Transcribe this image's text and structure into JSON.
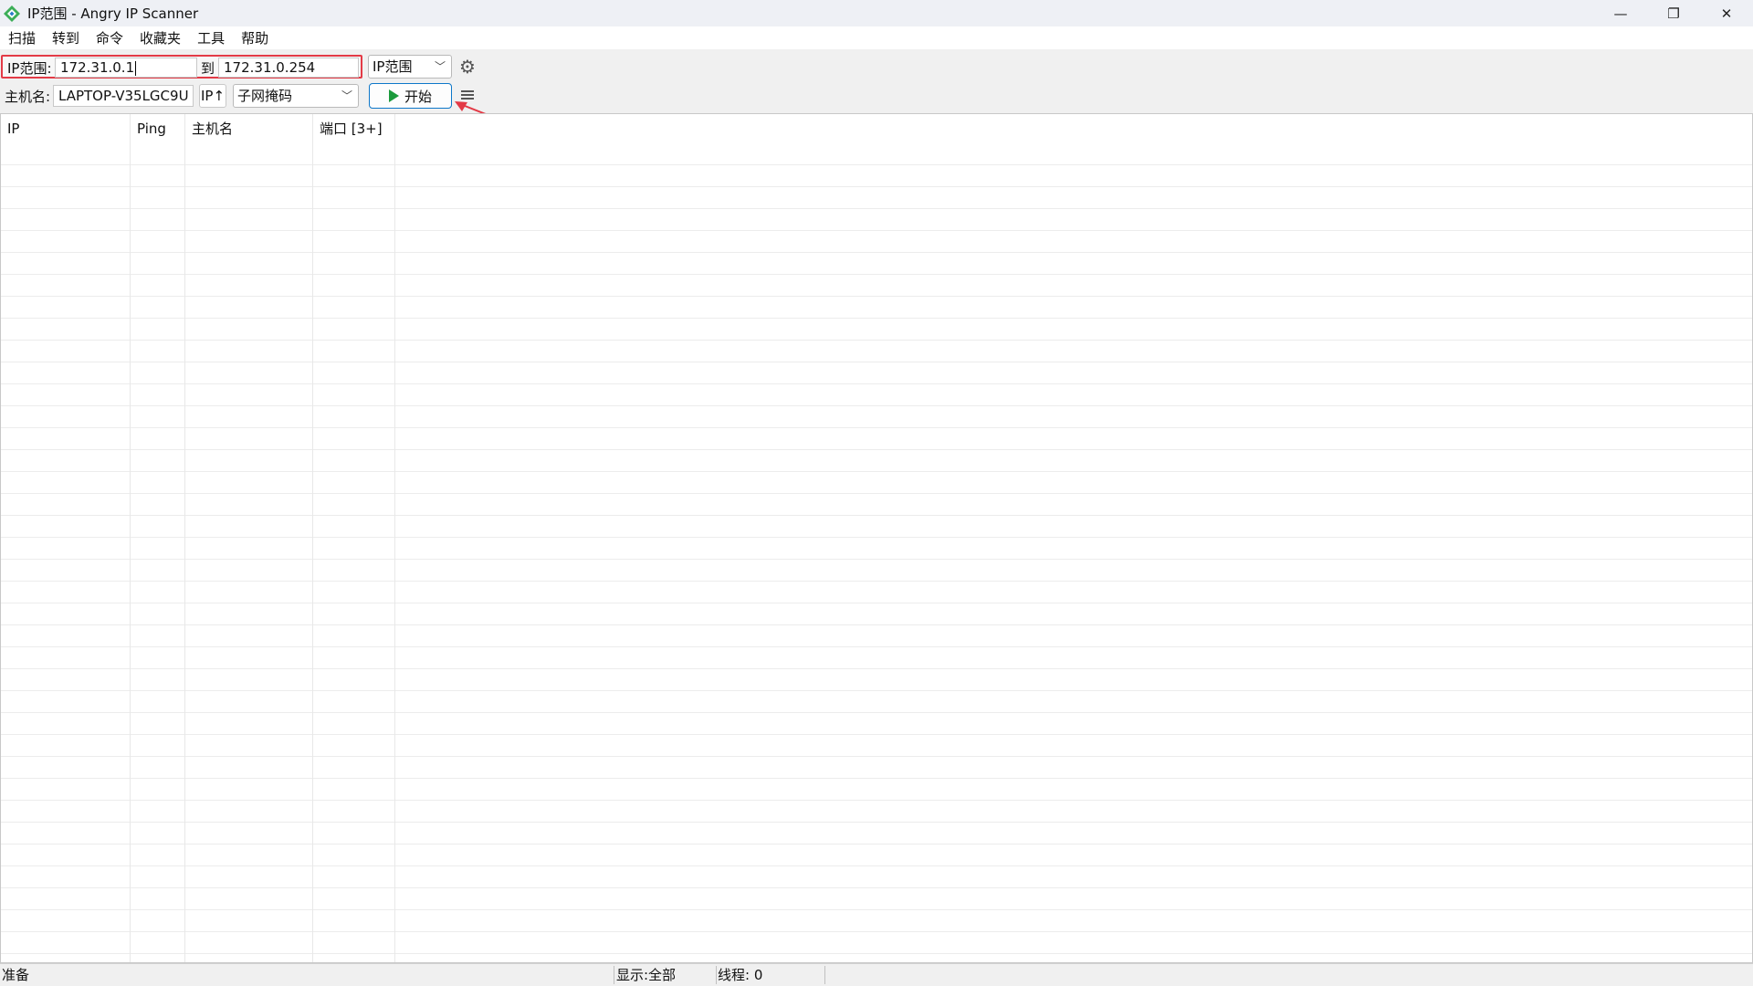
{
  "window": {
    "title": "IP范围 - Angry IP Scanner",
    "controls": {
      "minimize": "—",
      "maximize": "❐",
      "close": "✕"
    }
  },
  "menu": [
    "扫描",
    "转到",
    "命令",
    "收藏夹",
    "工具",
    "帮助"
  ],
  "toolbar": {
    "range_label": "IP范围:",
    "start_ip": "172.31.0.1",
    "to_label": "到",
    "end_ip": "172.31.0.254",
    "feeder_select": "IP范围",
    "hostname_label": "主机名:",
    "hostname_value": "LAPTOP-V35LGC9U",
    "ip_button": "IP↑",
    "netmask_select": "子网掩码",
    "start_button": "开始"
  },
  "table": {
    "columns": [
      "IP",
      "Ping",
      "主机名",
      "端口 [3+]"
    ]
  },
  "status": {
    "ready": "准备",
    "display": "显示:全部",
    "threads": "线程: 0"
  },
  "colors": {
    "highlight_border": "#e33a46",
    "start_button_border": "#0d77c9",
    "play_icon": "#1b9a3c"
  }
}
